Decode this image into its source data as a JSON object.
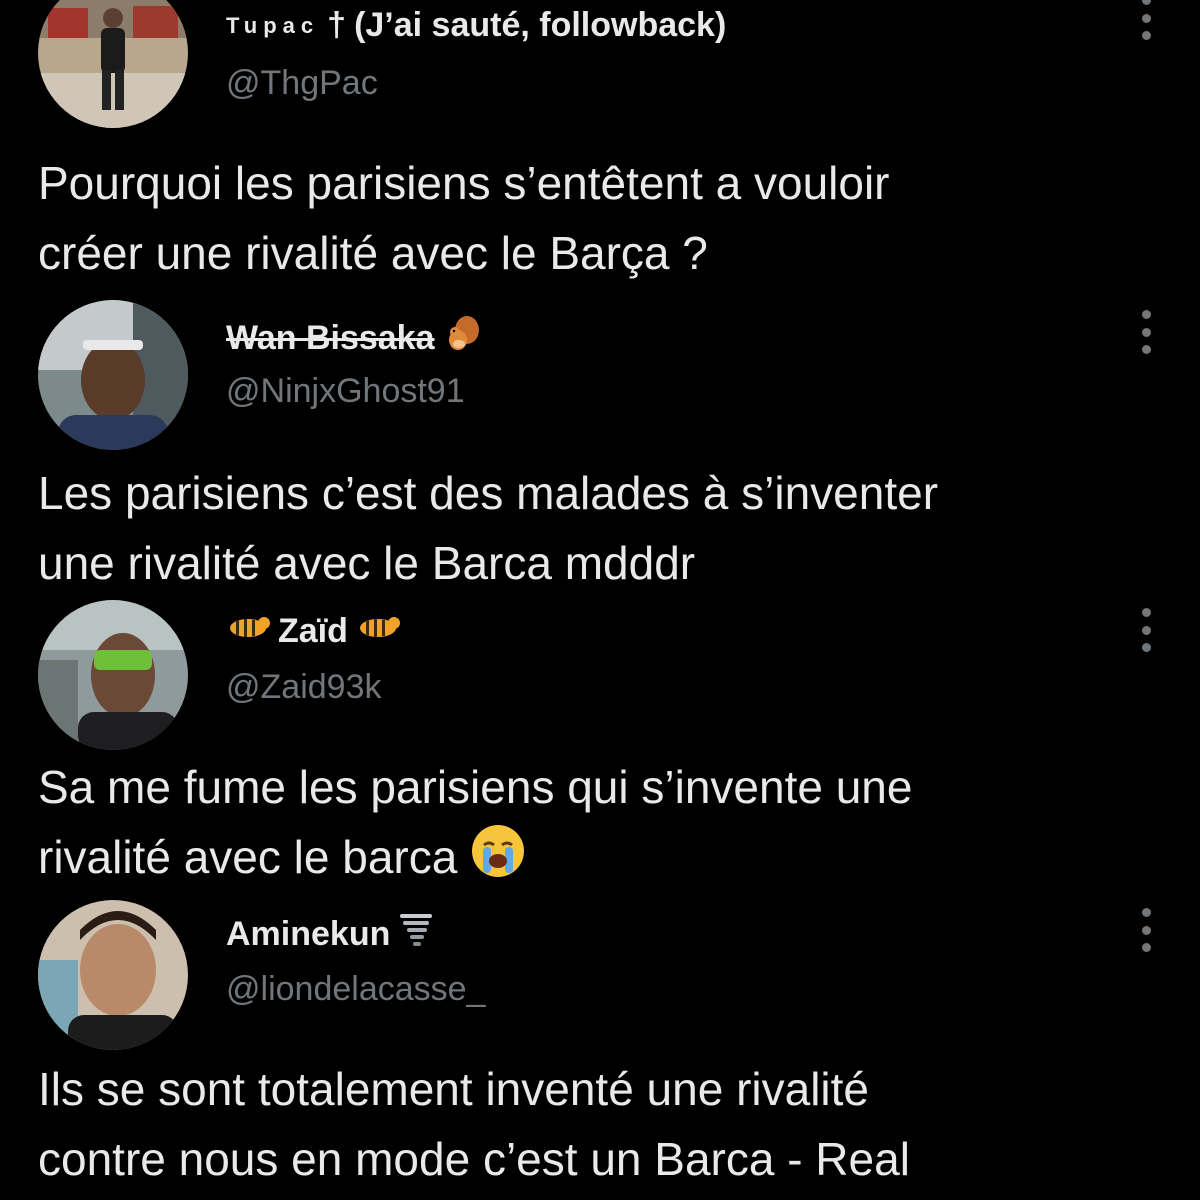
{
  "tweets": [
    {
      "name_prefix": "Tupac",
      "name_dagger": "†",
      "name": "(J’ai sauté, followback)",
      "handle": "@ThgPac",
      "text_lines": [
        "Pourquoi les parisiens s’entêtent a vouloir",
        "créer une rivalité avec le Barça ?"
      ],
      "name_emoji": "",
      "text_emoji": ""
    },
    {
      "name": "Wan Bissaka",
      "handle": "@NinjxGhost91",
      "name_emoji": "squirrel-emoji",
      "text_lines": [
        "Les parisiens c’est des malades à s’inventer",
        "une rivalité avec le Barca mdddr"
      ],
      "text_emoji": ""
    },
    {
      "name": "Zaïd",
      "handle": "@Zaid93k",
      "name_emoji": "tiger-emoji",
      "text_lines": [
        "Sa me fume les parisiens qui s’invente une",
        "rivalité avec le barca"
      ],
      "text_emoji": "loudly-crying-face-emoji"
    },
    {
      "name": "Aminekun",
      "handle": "@liondelacasse_",
      "name_emoji": "tornado-emoji",
      "text_lines": [
        "Ils se sont totalement inventé une rivalité",
        "contre nous en mode c’est un Barca - Real"
      ],
      "text_emoji": ""
    }
  ],
  "colors": {
    "background": "#000000",
    "text": "#e7e9ea",
    "secondary": "#71767b"
  }
}
